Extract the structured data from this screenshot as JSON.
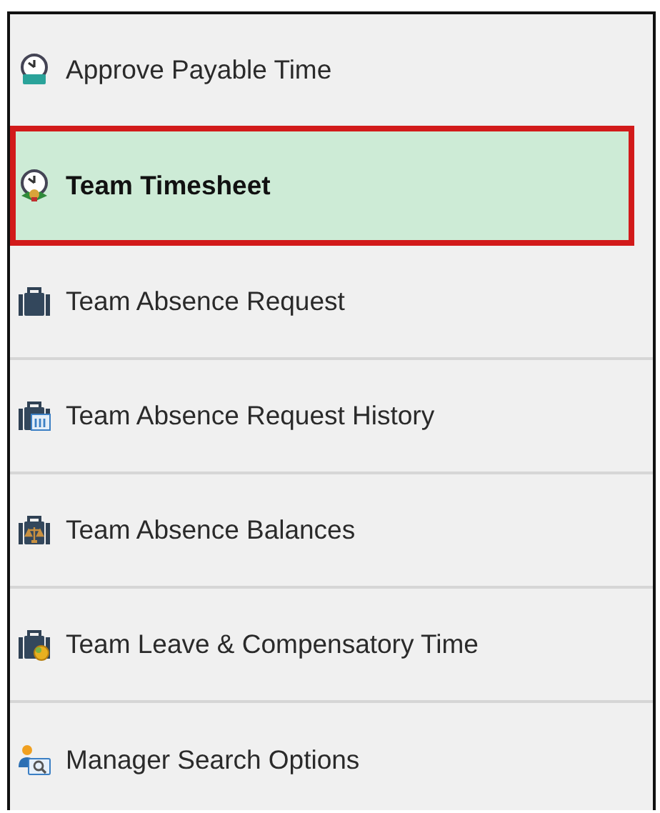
{
  "menu": {
    "items": [
      {
        "label": "Approve Payable Time",
        "selected": false
      },
      {
        "label": "Team Timesheet",
        "selected": true
      },
      {
        "label": "Team Absence Request",
        "selected": false
      },
      {
        "label": "Team Absence Request History",
        "selected": false
      },
      {
        "label": "Team Absence Balances",
        "selected": false
      },
      {
        "label": "Team Leave & Compensatory Time",
        "selected": false
      },
      {
        "label": "Manager Search Options",
        "selected": false
      }
    ]
  }
}
